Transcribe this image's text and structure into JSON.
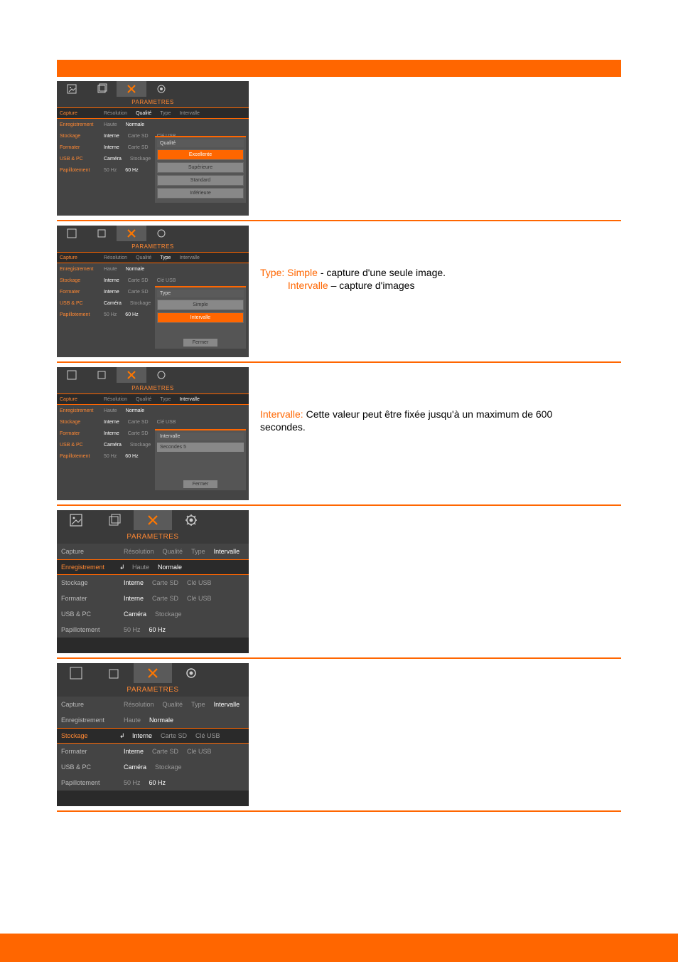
{
  "header": "",
  "row1": {
    "popup_title": "Qualité",
    "popup_items": [
      "Excellente",
      "Supérieure",
      "Standard",
      "Inférieure"
    ],
    "desc_lines": [
      "",
      "",
      "",
      ""
    ]
  },
  "row2": {
    "popup_title": "Type",
    "popup_items": [
      "Simple",
      "Intervalle"
    ],
    "desc_l1": "Type: Simple",
    "desc_l1_tail": " - capture d'une seule image.",
    "desc_l2": "Intervalle",
    "desc_l2_tail": " – capture d'images"
  },
  "row3": {
    "popup_title": "Intervalle",
    "popup_label": "Secondes",
    "desc_l1": "Intervalle: ",
    "desc_l1_tail": "Cette valeur peut être fixée jusqu'à un maximum de 600",
    "desc_l2": "secondes."
  },
  "row4": {
    "label": "Enregistrement",
    "desc": ""
  },
  "row5": {
    "label": "Stockage",
    "desc": ""
  },
  "settings": {
    "title": "PARAMETRES",
    "rows": {
      "capture": "Capture",
      "enreg": "Enregistrement",
      "stockage": "Stockage",
      "formater": "Formater",
      "usb": "USB & PC",
      "papillo": "Papillotement"
    },
    "cols": {
      "resolution": "Résolution",
      "qualite": "Qualité",
      "type": "Type",
      "intervalle": "Intervalle",
      "haute": "Haute",
      "normale": "Normale",
      "interne": "Interne",
      "cartesd": "Carte SD",
      "cleusb": "Clé USB",
      "camera": "Caméra",
      "stockage2": "Stockage",
      "hz50": "50 Hz",
      "hz60": "60 Hz"
    },
    "close": "Fermer"
  },
  "footer": {
    "left": "",
    "right": ""
  }
}
